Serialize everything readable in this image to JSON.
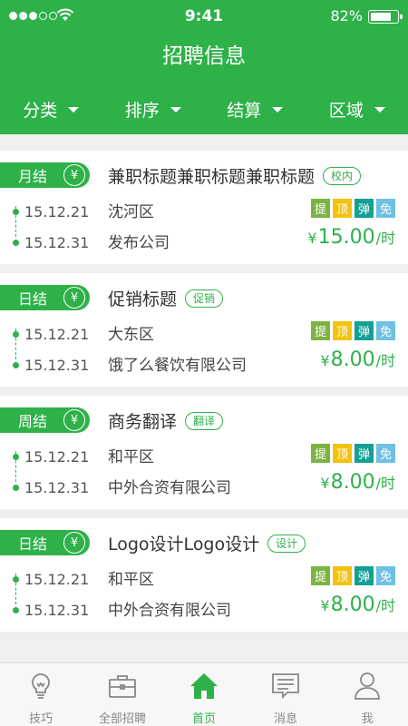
{
  "status": {
    "time": "9:41",
    "battery": "82%",
    "battery_level": 0.82
  },
  "title": "招聘信息",
  "filters": [
    "分类",
    "排序",
    "结算",
    "区域"
  ],
  "colors": {
    "primary": "#2eb149",
    "badge_ti": "#7cb342",
    "badge_ding": "#f4c20d",
    "badge_dan": "#15a095",
    "badge_mian": "#6ec1e4"
  },
  "badges": [
    "提",
    "顶",
    "弹",
    "免"
  ],
  "jobs": [
    {
      "pay": "月结",
      "pay_icon": "¥",
      "title": "兼职标题兼职标题兼职标题",
      "tag": "校内",
      "start": "15.12.21",
      "end": "15.12.31",
      "district": "沈河区",
      "company": "发布公司",
      "currency": "¥",
      "amount": "15.00",
      "unit": "/时"
    },
    {
      "pay": "日结",
      "pay_icon": "¥",
      "title": "促销标题",
      "tag": "促销",
      "start": "15.12.21",
      "end": "15.12.31",
      "district": "大东区",
      "company": "饿了么餐饮有限公司",
      "currency": "¥",
      "amount": "8.00",
      "unit": "/时"
    },
    {
      "pay": "周结",
      "pay_icon": "¥",
      "title": "商务翻译",
      "tag": "翻译",
      "start": "15.12.21",
      "end": "15.12.31",
      "district": "和平区",
      "company": "中外合资有限公司",
      "currency": "¥",
      "amount": "8.00",
      "unit": "/时"
    },
    {
      "pay": "日结",
      "pay_icon": "¥",
      "title": "Logo设计Logo设计",
      "tag": "设计",
      "start": "15.12.21",
      "end": "15.12.31",
      "district": "和平区",
      "company": "中外合资有限公司",
      "currency": "¥",
      "amount": "8.00",
      "unit": "/时"
    }
  ],
  "tabs": [
    {
      "label": "技巧",
      "icon": "lightbulb-icon"
    },
    {
      "label": "全部招聘",
      "icon": "briefcase-icon"
    },
    {
      "label": "首页",
      "icon": "home-icon"
    },
    {
      "label": "消息",
      "icon": "message-icon"
    },
    {
      "label": "我",
      "icon": "person-icon"
    }
  ]
}
